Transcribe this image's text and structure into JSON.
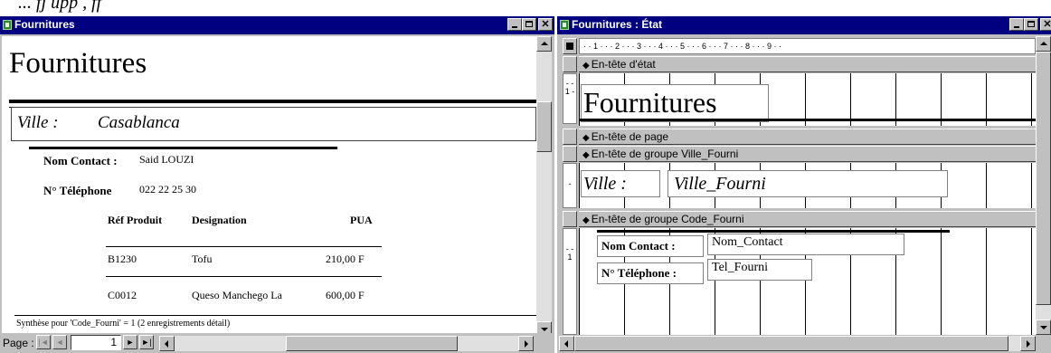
{
  "cut_text": "... fj  upp     ,  ff",
  "preview": {
    "window_title": "Fournitures",
    "report_title": "Fournitures",
    "ville_label": "Ville :",
    "ville_value": "Casablanca",
    "contact_label": "Nom Contact :",
    "contact_value": "Said LOUZI",
    "phone_label": "N° Téléphone",
    "phone_value": "022 22 25 30",
    "columns": [
      "Réf Produit",
      "Designation",
      "PUA"
    ],
    "rows": [
      {
        "ref": "B1230",
        "designation": "Tofu",
        "pua": "210,00 F"
      },
      {
        "ref": "C0012",
        "designation": "Queso Manchego La",
        "pua": "600,00 F"
      }
    ],
    "summary": "Synthèse pour 'Code_Fourni' = 1 (2 enregistrements détail)",
    "page_label": "Page :",
    "page_number": "1",
    "nav_first": "|◄",
    "nav_prev": "◄",
    "nav_next": "►",
    "nav_last": "►|"
  },
  "design": {
    "window_title": "Fournitures : État",
    "ruler": "· · 1 · · · 2 · · · 3 · · · 4 · · · 5 · · · 6 · · · 7 · · · 8 · · · 9 · ·",
    "ruler_v1": "- - 1 -",
    "ruler_v2": "-",
    "ruler_v3": "- - 1",
    "sections": {
      "report_header": "En-tête d'état",
      "page_header": "En-tête de page",
      "group_ville": "En-tête de groupe Ville_Fourni",
      "group_code": "En-tête de groupe Code_Fourni"
    },
    "title_ctrl": "Fournitures",
    "ville_label_ctrl": "Ville :",
    "ville_field_ctrl": "Ville_Fourni",
    "contact_label_ctrl": "Nom Contact :",
    "contact_field_ctrl": "Nom_Contact",
    "phone_label_ctrl": "N° Téléphone :",
    "phone_field_ctrl": "Tel_Fourni"
  },
  "colors": {
    "titlebar_active": "#000080",
    "window_face": "#c0c0c0"
  }
}
